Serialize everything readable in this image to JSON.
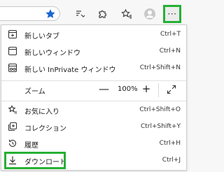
{
  "toolbar": {
    "icons": [
      "favorite-star-icon",
      "read-aloud-icon",
      "extensions-icon",
      "favorites-icon",
      "profile-icon",
      "more-icon"
    ],
    "more_label": "···",
    "accent": "#26b035",
    "star_color": "#1a67d2"
  },
  "menu": {
    "new_tab": {
      "label": "新しいタブ",
      "shortcut": "Ctrl+T"
    },
    "new_window": {
      "label": "新しいウィンドウ",
      "shortcut": "Ctrl+N"
    },
    "new_inprivate": {
      "label": "新しい InPrivate ウィンドウ",
      "shortcut": "Ctrl+Shift+N"
    },
    "zoom": {
      "label": "ズーム",
      "minus": "—",
      "value": "100%",
      "plus": "+"
    },
    "favorites": {
      "label": "お気に入り",
      "shortcut": "Ctrl+Shift+O"
    },
    "collections": {
      "label": "コレクション",
      "shortcut": "Ctrl+Shift+Y"
    },
    "history": {
      "label": "履歴",
      "shortcut": "Ctrl+H"
    },
    "downloads": {
      "label": "ダウンロード",
      "shortcut": "Ctrl+J"
    }
  }
}
